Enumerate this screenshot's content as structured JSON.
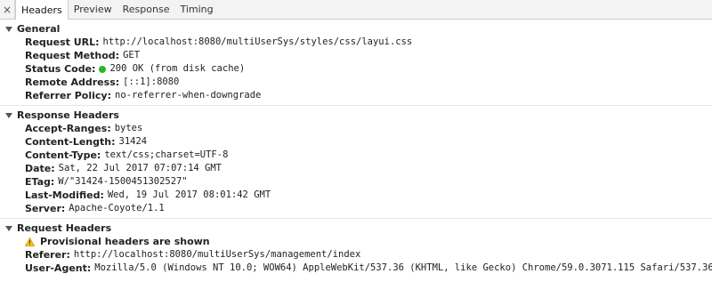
{
  "tabs": {
    "close_glyph": "×",
    "items": [
      "Headers",
      "Preview",
      "Response",
      "Timing"
    ],
    "active": "Headers"
  },
  "general": {
    "title": "General",
    "request_url_key": "Request URL:",
    "request_url": "http://localhost:8080/multiUserSys/styles/css/layui.css",
    "request_method_key": "Request Method:",
    "request_method": "GET",
    "status_code_key": "Status Code:",
    "status_code": "200 OK (from disk cache)",
    "remote_address_key": "Remote Address:",
    "remote_address": "[::1]:8080",
    "referrer_policy_key": "Referrer Policy:",
    "referrer_policy": "no-referrer-when-downgrade"
  },
  "response_headers": {
    "title": "Response Headers",
    "rows": [
      {
        "key": "Accept-Ranges:",
        "value": "bytes"
      },
      {
        "key": "Content-Length:",
        "value": "31424"
      },
      {
        "key": "Content-Type:",
        "value": "text/css;charset=UTF-8"
      },
      {
        "key": "Date:",
        "value": "Sat, 22 Jul 2017 07:07:14 GMT"
      },
      {
        "key": "ETag:",
        "value": "W/\"31424-1500451302527\""
      },
      {
        "key": "Last-Modified:",
        "value": "Wed, 19 Jul 2017 08:01:42 GMT"
      },
      {
        "key": "Server:",
        "value": "Apache-Coyote/1.1"
      }
    ]
  },
  "request_headers": {
    "title": "Request Headers",
    "warning": "Provisional headers are shown",
    "referer_key": "Referer:",
    "referer": "http://localhost:8080/multiUserSys/management/index",
    "user_agent_key": "User-Agent:",
    "user_agent": "Mozilla/5.0 (Windows NT 10.0; WOW64) AppleWebKit/537.36 (KHTML, like Gecko) Chrome/59.0.3071.115 Safari/537.36"
  },
  "colors": {
    "status_ok": "#2bb52b",
    "warning": "#f5c518"
  }
}
